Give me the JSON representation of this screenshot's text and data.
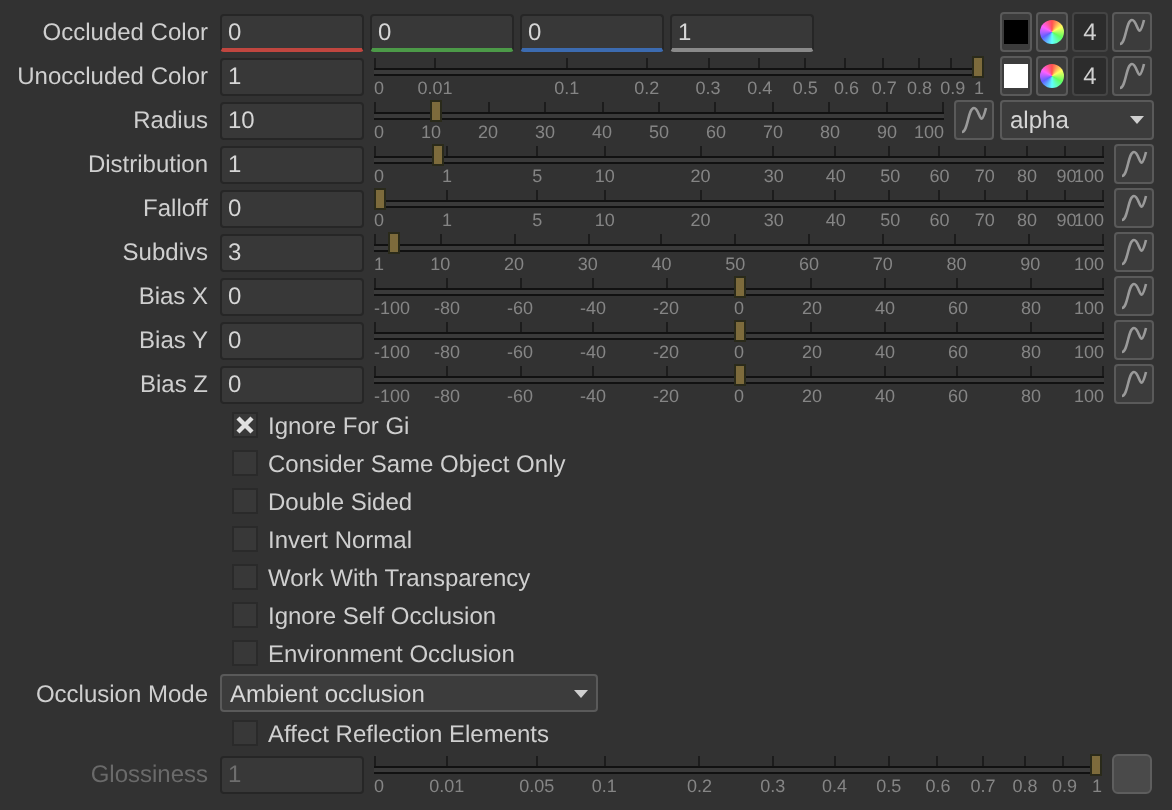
{
  "knobs": [
    {
      "kind": "rgba",
      "label": "Occluded Color",
      "fields": [
        {
          "value": "0",
          "color": "#c0463f"
        },
        {
          "value": "0",
          "color": "#4c9a48"
        },
        {
          "value": "0",
          "color": "#3c6bb0"
        },
        {
          "value": "1",
          "color": "#8a8a8a"
        }
      ],
      "swatch": {
        "color": "#000000"
      },
      "channels": "4"
    },
    {
      "kind": "color",
      "label": "Unoccluded Color",
      "value": "1",
      "slider": {
        "kind": "sqrt",
        "level": 1,
        "ticks": [
          "0",
          "0.01",
          "0.1",
          "0.2",
          "0.3",
          "0.4",
          "0.5",
          "0.6",
          "0.7",
          "0.8",
          "0.9",
          "1"
        ]
      },
      "swatch": {
        "color": "#ffffff"
      },
      "channels": "4"
    },
    {
      "kind": "slider_menu",
      "label": "Radius",
      "value": "10",
      "slider": {
        "kind": "linear",
        "level": 0.1,
        "ticks": [
          "0",
          "10",
          "20",
          "30",
          "40",
          "50",
          "60",
          "70",
          "80",
          "90",
          "100"
        ]
      },
      "menu": "alpha"
    },
    {
      "kind": "slider",
      "label": "Distribution",
      "value": "1",
      "slider": {
        "kind": "sqrt",
        "level": 0.08,
        "ticks": [
          "0",
          "1",
          "5",
          "10",
          "20",
          "30",
          "40",
          "50",
          "60",
          "70",
          "80",
          "90",
          "100"
        ]
      }
    },
    {
      "kind": "slider",
      "label": "Falloff",
      "value": "0",
      "slider": {
        "kind": "sqrt",
        "level": 0,
        "ticks": [
          "0",
          "1",
          "5",
          "10",
          "20",
          "30",
          "40",
          "50",
          "60",
          "70",
          "80",
          "90",
          "100"
        ]
      }
    },
    {
      "kind": "slider",
      "label": "Subdivs",
      "value": "3",
      "slider": {
        "kind": "linear",
        "level": 0.02,
        "ticks": [
          "1",
          "10",
          "20",
          "30",
          "40",
          "50",
          "60",
          "70",
          "80",
          "90",
          "100"
        ]
      }
    },
    {
      "kind": "slider",
      "label": "Bias X",
      "value": "0",
      "slider": {
        "kind": "linear",
        "level": 0.5,
        "ticks": [
          "-100",
          "-80",
          "-60",
          "-40",
          "-20",
          "0",
          "20",
          "40",
          "60",
          "80",
          "100"
        ]
      }
    },
    {
      "kind": "slider",
      "label": "Bias Y",
      "value": "0",
      "slider": {
        "kind": "linear",
        "level": 0.5,
        "ticks": [
          "-100",
          "-80",
          "-60",
          "-40",
          "-20",
          "0",
          "20",
          "40",
          "60",
          "80",
          "100"
        ]
      }
    },
    {
      "kind": "slider",
      "label": "Bias Z",
      "value": "0",
      "slider": {
        "kind": "linear",
        "level": 0.5,
        "ticks": [
          "-100",
          "-80",
          "-60",
          "-40",
          "-20",
          "0",
          "20",
          "40",
          "60",
          "80",
          "100"
        ]
      }
    }
  ],
  "checkboxes": [
    {
      "label": "Ignore For Gi",
      "checked": true
    },
    {
      "label": "Consider Same Object Only",
      "checked": false
    },
    {
      "label": "Double Sided",
      "checked": false
    },
    {
      "label": "Invert Normal",
      "checked": false
    },
    {
      "label": "Work With Transparency",
      "checked": false
    },
    {
      "label": "Ignore Self Occlusion",
      "checked": false
    },
    {
      "label": "Environment Occlusion",
      "checked": false
    }
  ],
  "occlusion_mode": {
    "label": "Occlusion Mode",
    "value": "Ambient occlusion"
  },
  "affect_reflection": {
    "label": "Affect Reflection Elements",
    "checked": false
  },
  "glossiness": {
    "label": "Glossiness",
    "value": "1",
    "disabled": true,
    "slider": {
      "kind": "sqrt",
      "level": 1,
      "ticks": [
        "0",
        "0.01",
        "0.05",
        "0.1",
        "0.2",
        "0.3",
        "0.4",
        "0.5",
        "0.6",
        "0.7",
        "0.8",
        "0.9",
        "1"
      ]
    }
  }
}
